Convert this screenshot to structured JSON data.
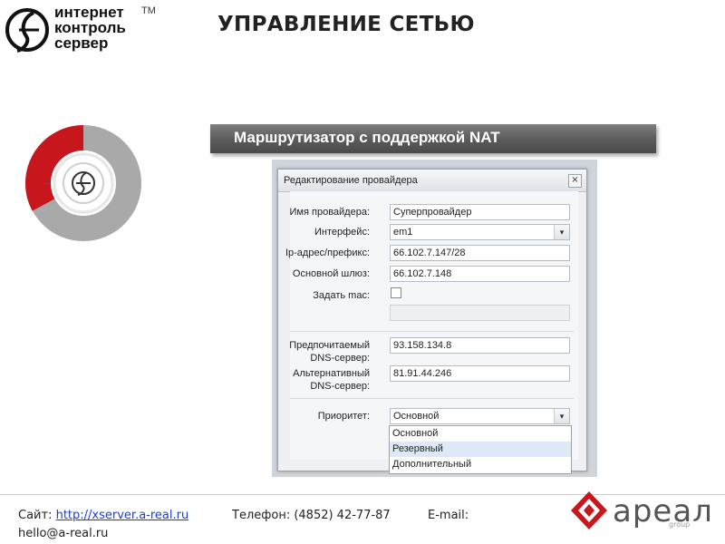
{
  "logo": {
    "line1": "интернет",
    "line2": "контроль",
    "line3": "сервер",
    "tm": "TM"
  },
  "title": "УПРАВЛЕНИЕ СЕТЬЮ",
  "banner": "Маршрутизатор с поддержкой NAT",
  "dialog": {
    "title": "Редактирование провайдера",
    "close": "×",
    "fields": {
      "provider_label": "Имя провайдера:",
      "provider_value": "Суперпровайдер",
      "interface_label": "Интерфейс:",
      "interface_value": "em1",
      "ip_label": "Ip-адрес/префикс:",
      "ip_value": "66.102.7.147/28",
      "gateway_label": "Основной шлюз:",
      "gateway_value": "66.102.7.148",
      "mac_label": "Задать mac:",
      "dns1_label_l1": "Предпочитаемый",
      "dns1_label_l2": "DNS-сервер:",
      "dns1_value": "93.158.134.8",
      "dns2_label_l1": "Альтернативный",
      "dns2_label_l2": "DNS-сервер:",
      "dns2_value": "81.91.44.246",
      "priority_label": "Приоритет:",
      "priority_value": "Основной"
    },
    "dropdown_icon": "▾",
    "priority_options": [
      "Основной",
      "Резервный",
      "Дополнительный"
    ],
    "priority_highlighted": "Резервный"
  },
  "footer": {
    "site_label": "Сайт:",
    "site_link": "http://xserver.a-real.ru",
    "phone": "Телефон: (4852) 42-77-87",
    "email_label": "E-mail:",
    "email": "hello@a-real.ru"
  },
  "brand": {
    "name": "ареал",
    "sub": "group"
  },
  "colors": {
    "accent_red": "#c8161d",
    "ring_gray": "#a9a9a9",
    "banner_gray": "#5f5f5f",
    "link_blue": "#1a3fd6"
  }
}
